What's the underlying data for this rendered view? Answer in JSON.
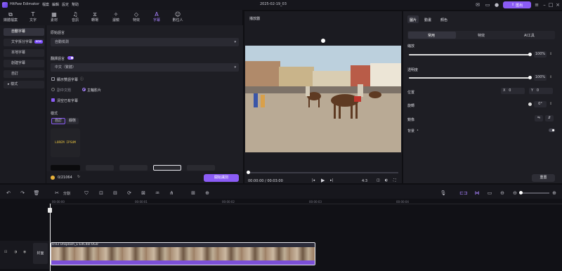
{
  "app": {
    "title": "HitPaw Edimakor",
    "menu": [
      "檔案",
      "編輯",
      "設定",
      "幫助"
    ],
    "project_name": "2025-02-19_03",
    "export_label": "匯出"
  },
  "toolbar": [
    {
      "label": "媒體檔案",
      "icon": "media-icon"
    },
    {
      "label": "文字",
      "icon": "text-icon"
    },
    {
      "label": "素材",
      "icon": "assets-icon"
    },
    {
      "label": "音訊",
      "icon": "audio-icon"
    },
    {
      "label": "轉場",
      "icon": "transition-icon"
    },
    {
      "label": "濾鏡",
      "icon": "filter-icon"
    },
    {
      "label": "特效",
      "icon": "effects-icon"
    },
    {
      "label": "字幕",
      "icon": "subtitle-icon",
      "active": true
    },
    {
      "label": "數位人",
      "icon": "avatar-icon"
    }
  ],
  "leftnav": [
    {
      "label": "自動字幕",
      "selected": true
    },
    {
      "label": "文字拆分字幕",
      "badge": "NEW"
    },
    {
      "label": "本地字幕"
    },
    {
      "label": "創建字幕"
    },
    {
      "label": "自訂"
    },
    {
      "label": "樣式",
      "arrow": "▸"
    }
  ],
  "subtitle": {
    "source_lang_label": "原始語言",
    "source_lang_value": "自動檢測",
    "translate_label": "翻譯語言",
    "target_lang_value": "中文（繁體）",
    "bilingual_label": "顯示雙語字幕",
    "sub_caption_label": "副中文題",
    "main_video_label": "主軸影片",
    "clear_label": "清空已有字幕",
    "style_label": "樣式",
    "style_tabs": [
      "自訂",
      "靜態"
    ],
    "preview_text": "LOREM IPSUM",
    "credits": "0/21064",
    "start_label": "開始識別"
  },
  "player": {
    "title": "播放器",
    "time": "00:00:00 / 00:03:00",
    "ratio": "4:3"
  },
  "props": {
    "tabs": [
      "圖片",
      "動畫",
      "顏色"
    ],
    "subtabs": [
      "常用",
      "特效",
      "AI工具"
    ],
    "scale_label": "縮放",
    "scale_value": "100%",
    "scale_level": 1.0,
    "opacity_label": "透明度",
    "opacity_value": "100%",
    "opacity_level": 1.0,
    "position_label": "位置",
    "pos_x_label": "X",
    "pos_x": "0",
    "pos_y_label": "Y",
    "pos_y": "0",
    "rotate_label": "旋轉",
    "rotate_value": "0°",
    "mirror_label": "鏡像",
    "bg_label": "背景",
    "reset_label": "重置"
  },
  "timeline": {
    "split_label": "分割",
    "ticks": [
      "00:00:00",
      "00:00:01",
      "00:00:02",
      "00:00:03",
      "00:00:04"
    ],
    "cover_label": "封面",
    "clip_name": "0:03 Unsplash_E-EdC4kFOG0"
  },
  "colors": {
    "accent": "#8b5cf6",
    "bg": "#0f0f13"
  }
}
